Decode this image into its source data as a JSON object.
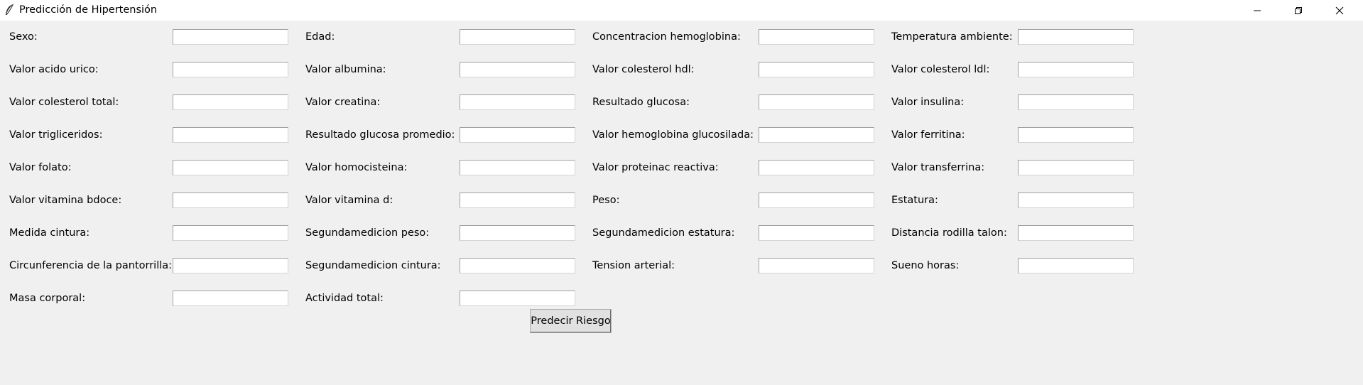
{
  "window": {
    "title": "Predicción de Hipertensión",
    "icon": "feather-icon",
    "controls": [
      "minimize-icon",
      "restore-icon",
      "close-icon"
    ]
  },
  "form": {
    "columns": [
      {
        "fields": [
          {
            "label": "Sexo:",
            "value": ""
          },
          {
            "label": "Valor acido urico:",
            "value": ""
          },
          {
            "label": "Valor colesterol total:",
            "value": ""
          },
          {
            "label": "Valor trigliceridos:",
            "value": ""
          },
          {
            "label": "Valor folato:",
            "value": ""
          },
          {
            "label": "Valor vitamina bdoce:",
            "value": ""
          },
          {
            "label": "Medida cintura:",
            "value": ""
          },
          {
            "label": "Circunferencia de la pantorrilla:",
            "value": ""
          },
          {
            "label": "Masa corporal:",
            "value": ""
          }
        ]
      },
      {
        "fields": [
          {
            "label": "Edad:",
            "value": ""
          },
          {
            "label": "Valor albumina:",
            "value": ""
          },
          {
            "label": "Valor creatina:",
            "value": ""
          },
          {
            "label": "Resultado glucosa promedio:",
            "value": ""
          },
          {
            "label": "Valor homocisteina:",
            "value": ""
          },
          {
            "label": "Valor vitamina d:",
            "value": ""
          },
          {
            "label": "Segundamedicion peso:",
            "value": ""
          },
          {
            "label": "Segundamedicion cintura:",
            "value": ""
          },
          {
            "label": "Actividad total:",
            "value": ""
          }
        ]
      },
      {
        "fields": [
          {
            "label": "Concentracion hemoglobina:",
            "value": ""
          },
          {
            "label": "Valor colesterol hdl:",
            "value": ""
          },
          {
            "label": "Resultado glucosa:",
            "value": ""
          },
          {
            "label": "Valor hemoglobina glucosilada:",
            "value": ""
          },
          {
            "label": "Valor proteinac reactiva:",
            "value": ""
          },
          {
            "label": "Peso:",
            "value": ""
          },
          {
            "label": "Segundamedicion estatura:",
            "value": ""
          },
          {
            "label": "Tension arterial:",
            "value": ""
          }
        ]
      },
      {
        "fields": [
          {
            "label": "Temperatura ambiente:",
            "value": ""
          },
          {
            "label": "Valor colesterol ldl:",
            "value": ""
          },
          {
            "label": "Valor insulina:",
            "value": ""
          },
          {
            "label": "Valor ferritina:",
            "value": ""
          },
          {
            "label": "Valor transferrina:",
            "value": ""
          },
          {
            "label": "Estatura:",
            "value": ""
          },
          {
            "label": "Distancia rodilla talon:",
            "value": ""
          },
          {
            "label": "Sueno horas:",
            "value": ""
          }
        ]
      }
    ]
  },
  "actions": {
    "predict_label": "Predecir Riesgo"
  }
}
